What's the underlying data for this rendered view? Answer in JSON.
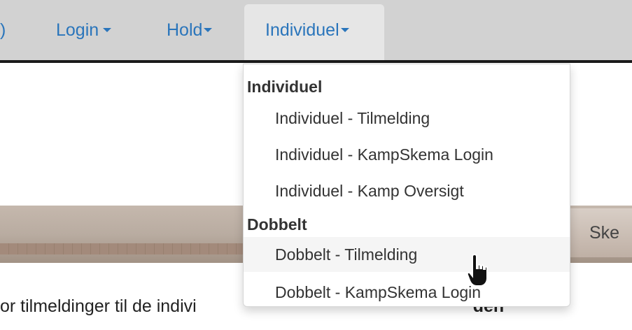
{
  "navbar": {
    "partial_item": ")",
    "items": [
      {
        "label": "Login"
      },
      {
        "label": "Hold"
      },
      {
        "label": "Individuel"
      }
    ],
    "accent_color": "#2a75bb"
  },
  "dropdown": {
    "sections": [
      {
        "header": "Individuel",
        "items": [
          "Individuel - Tilmelding",
          "Individuel - KampSkema Login",
          "Individuel - Kamp Oversigt"
        ]
      },
      {
        "header": "Dobbelt",
        "items": [
          "Dobbelt - Tilmelding",
          "Dobbelt - KampSkema Login"
        ]
      }
    ],
    "hovered_item": "Dobbelt - Tilmelding"
  },
  "right_button": {
    "label": "Ske"
  },
  "page": {
    "text_start": "or tilmeldinger til de indivi",
    "text_end": "den"
  }
}
